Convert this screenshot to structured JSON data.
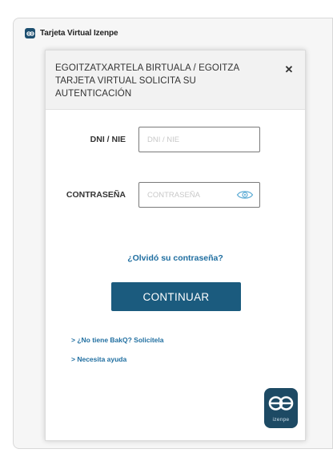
{
  "window": {
    "title": "Tarjeta Virtual Izenpe"
  },
  "dialog": {
    "title": "EGOITZATXARTELA BIRTUALA / EGOITZA TARJETA VIRTUAL  SOLICITA SU AUTENTICACIÓN",
    "close_symbol": "✕"
  },
  "form": {
    "dni": {
      "label": "DNI / NIE",
      "placeholder": "DNI / NIE",
      "value": ""
    },
    "password": {
      "label": "CONTRASEÑA",
      "placeholder": "CONTRASEÑA",
      "value": ""
    },
    "forgot_password": "¿Olvidó su contraseña?",
    "continue_label": "CONTINUAR"
  },
  "links": {
    "request_bakq": "> ¿No tiene BakQ? Solicítela",
    "help": "> Necesita ayuda"
  },
  "brand": {
    "logo_text": "izenpe"
  },
  "colors": {
    "primary": "#1b5b7e",
    "link": "#1f6ea0",
    "logo_bg": "#1d4a64"
  }
}
